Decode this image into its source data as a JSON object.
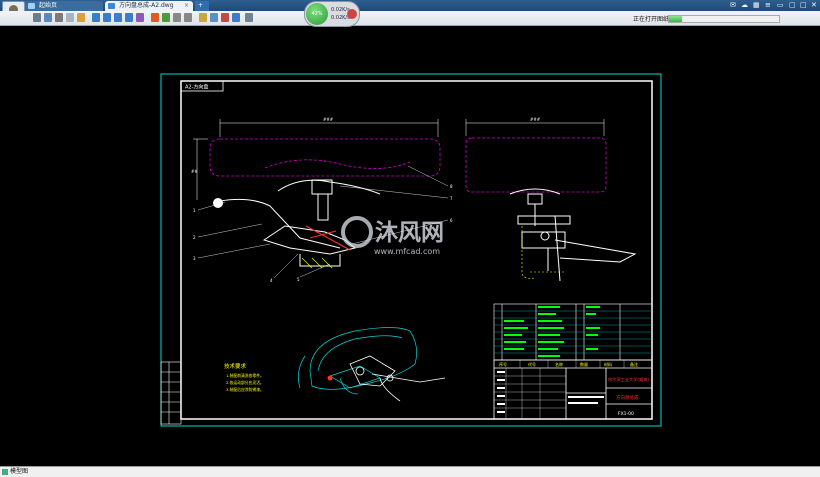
{
  "tabs": [
    {
      "label": "起始页"
    },
    {
      "label": "方向盘总成-A2.dwg"
    },
    {
      "label": "+"
    }
  ],
  "speed": {
    "percent": "42%",
    "upload": "0.02K/s",
    "download": "0.02K/s"
  },
  "status": {
    "text": "正在打开图纸",
    "progress": 0.12
  },
  "drawing": {
    "stamp": "A2-方向盘",
    "dims": [
      "###",
      "###",
      "##"
    ],
    "part_numbers": [
      "1",
      "2",
      "3",
      "4",
      "5",
      "6",
      "7",
      "8"
    ],
    "watermark": "沐风网",
    "watermark_url": "www.mfcad.com",
    "notes_title": "技术要求",
    "notes": [
      "1.装配前清洗各零件。",
      "2.各运动部分应灵活。",
      "3.装配后应涂防锈漆。"
    ],
    "title_school": "哈尔滨工业大学(威海)",
    "title_name": "方向盘总成",
    "drawing_code": "FX1-00",
    "header_cells": [
      "序号",
      "代号",
      "名称",
      "数量",
      "材料",
      "备注"
    ],
    "colors": {
      "white": "#ffffff",
      "magenta": "#d400d4",
      "cyan": "#00d8d8",
      "green": "#00ff00",
      "yellow": "#ffff00",
      "red": "#ff3030"
    }
  },
  "bottom": {
    "label": "模型图"
  }
}
